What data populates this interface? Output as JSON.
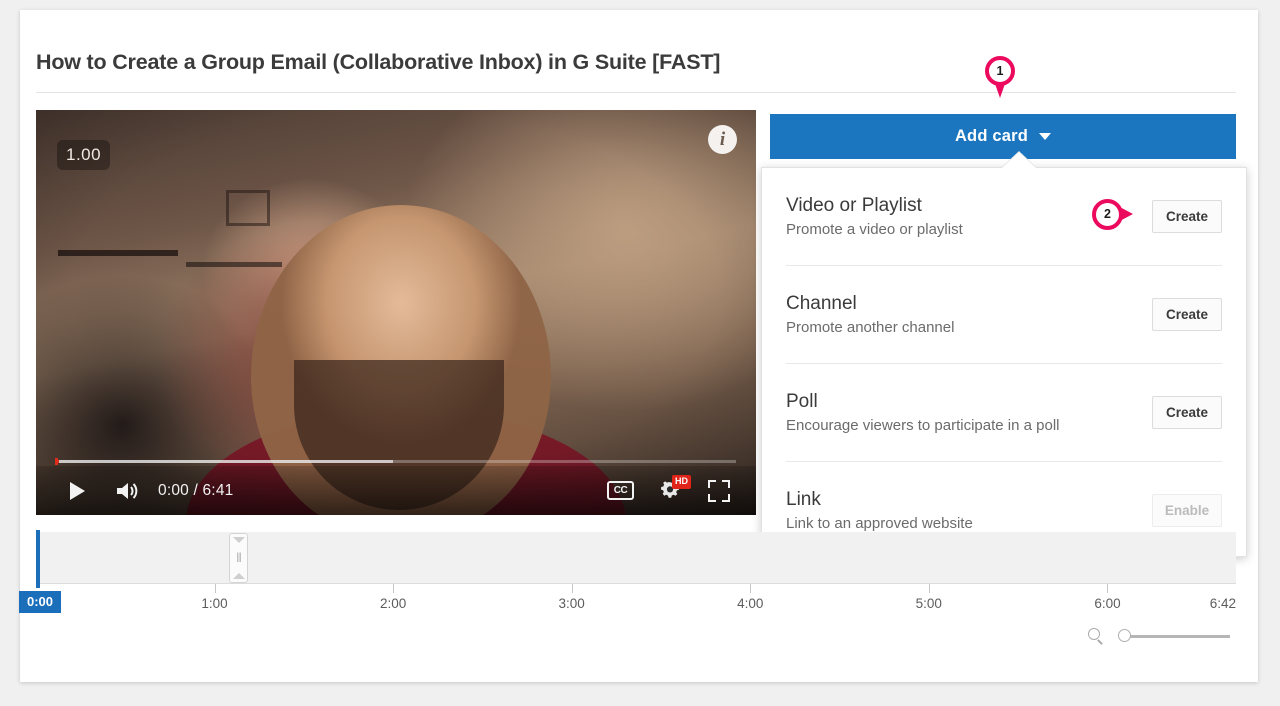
{
  "video": {
    "title": "How to Create a Group Email (Collaborative Inbox) in G Suite [FAST]",
    "speed_badge": "1.00",
    "info_icon": "i",
    "controls": {
      "play_label": "play",
      "volume_label": "volume",
      "time": "0:00 / 6:41",
      "current_time": "0:00",
      "duration": "6:41",
      "cc_label": "CC",
      "quality_badge": "HD",
      "settings_label": "settings",
      "fullscreen_label": "fullscreen"
    }
  },
  "toolbar": {
    "add_card_label": "Add card",
    "add_card_color": "#1b76bf"
  },
  "markers": [
    {
      "id": "1",
      "type": "pin",
      "target": "add-card-button"
    },
    {
      "id": "2",
      "type": "arrow",
      "target": "create-video-or-playlist-button"
    }
  ],
  "marker_color": "#ec0a5e",
  "dropdown": {
    "items": [
      {
        "title": "Video or Playlist",
        "subtitle": "Promote a video or playlist",
        "button_label": "Create",
        "disabled": false
      },
      {
        "title": "Channel",
        "subtitle": "Promote another channel",
        "button_label": "Create",
        "disabled": false
      },
      {
        "title": "Poll",
        "subtitle": "Encourage viewers to participate in a poll",
        "button_label": "Create",
        "disabled": false
      },
      {
        "title": "Link",
        "subtitle": "Link to an approved website",
        "button_label": "Enable",
        "disabled": true
      }
    ]
  },
  "timeline": {
    "playhead_label": "0:00",
    "playhead_color": "#1b6fba",
    "card_handle_label": "card marker",
    "ticks": [
      {
        "label": "1:00",
        "pos_pct": 14.88
      },
      {
        "label": "2:00",
        "pos_pct": 29.76
      },
      {
        "label": "3:00",
        "pos_pct": 44.64
      },
      {
        "label": "4:00",
        "pos_pct": 59.52
      },
      {
        "label": "5:00",
        "pos_pct": 74.4
      },
      {
        "label": "6:00",
        "pos_pct": 89.29
      }
    ],
    "end_label": "6:42",
    "zoom": {
      "icon": "magnifier-icon",
      "value_pct": 0
    }
  }
}
